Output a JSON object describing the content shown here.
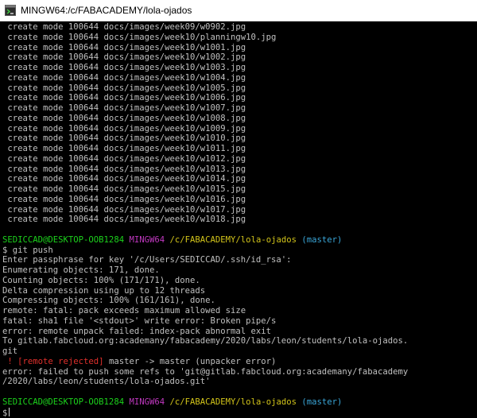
{
  "window": {
    "title": "MINGW64:/c/FABACADEMY/lola-ojados",
    "icon": "mingw-terminal-icon"
  },
  "colors": {
    "background": "#000000",
    "text": "#c0c0c0",
    "prompt_user": "#1cd21c",
    "prompt_env": "#c038c0",
    "prompt_path": "#d2c41a",
    "prompt_branch": "#3aa6d8",
    "error": "#e0302c"
  },
  "terminal": {
    "create_lines": [
      " create mode 100644 docs/images/week09/w0902.jpg",
      " create mode 100644 docs/images/week10/planningw10.jpg",
      " create mode 100644 docs/images/week10/w1001.jpg",
      " create mode 100644 docs/images/week10/w1002.jpg",
      " create mode 100644 docs/images/week10/w1003.jpg",
      " create mode 100644 docs/images/week10/w1004.jpg",
      " create mode 100644 docs/images/week10/w1005.jpg",
      " create mode 100644 docs/images/week10/w1006.jpg",
      " create mode 100644 docs/images/week10/w1007.jpg",
      " create mode 100644 docs/images/week10/w1008.jpg",
      " create mode 100644 docs/images/week10/w1009.jpg",
      " create mode 100644 docs/images/week10/w1010.jpg",
      " create mode 100644 docs/images/week10/w1011.jpg",
      " create mode 100644 docs/images/week10/w1012.jpg",
      " create mode 100644 docs/images/week10/w1013.jpg",
      " create mode 100644 docs/images/week10/w1014.jpg",
      " create mode 100644 docs/images/week10/w1015.jpg",
      " create mode 100644 docs/images/week10/w1016.jpg",
      " create mode 100644 docs/images/week10/w1017.jpg",
      " create mode 100644 docs/images/week10/w1018.jpg"
    ],
    "prompt": {
      "user_host": "SEDICCAD@DESKTOP-OOB1284",
      "env": "MINGW64",
      "path": "/c/FABACADEMY/lola-ojados",
      "branch": "(master)"
    },
    "command": "$ git push",
    "push_output": [
      "Enter passphrase for key '/c/Users/SEDICCAD/.ssh/id_rsa':",
      "Enumerating objects: 171, done.",
      "Counting objects: 100% (171/171), done.",
      "Delta compression using up to 12 threads",
      "Compressing objects: 100% (161/161), done.",
      "remote: fatal: pack exceeds maximum allowed size",
      "fatal: sha1 file '<stdout>' write error: Broken pipe/s",
      "error: remote unpack failed: index-pack abnormal exit",
      "To gitlab.fabcloud.org:academany/fabacademy/2020/labs/leon/students/lola-ojados.",
      "git"
    ],
    "rejected": {
      "marker": " ! [remote rejected]",
      "rest": " master -> master (unpacker error)"
    },
    "error_lines": [
      "error: failed to push some refs to 'git@gitlab.fabcloud.org:academany/fabacademy",
      "/2020/labs/leon/students/lola-ojados.git'"
    ],
    "final_prompt_symbol": "$"
  }
}
